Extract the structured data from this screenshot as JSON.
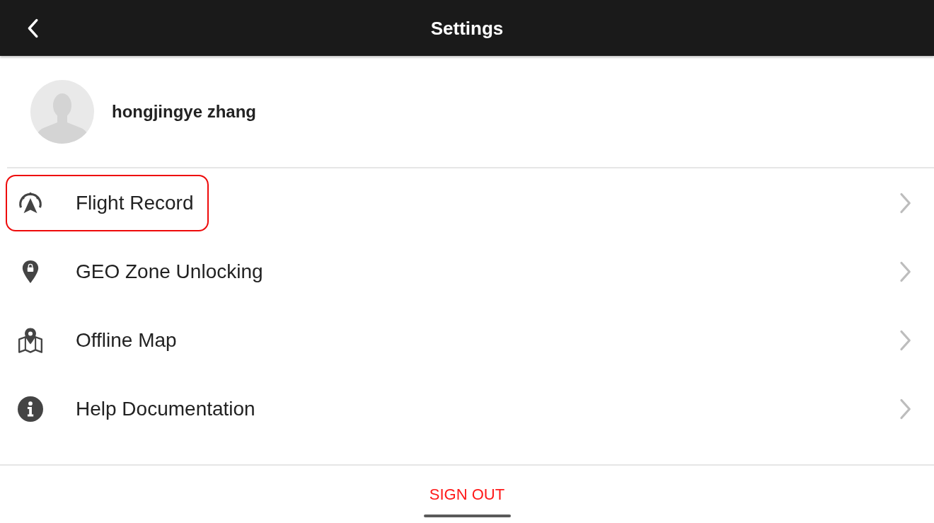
{
  "header": {
    "title": "Settings"
  },
  "profile": {
    "name": "hongjingye zhang"
  },
  "menu": [
    {
      "kind": "flight-record",
      "label": "Flight Record",
      "highlighted": true
    },
    {
      "kind": "geo-zone",
      "label": "GEO Zone Unlocking",
      "highlighted": false
    },
    {
      "kind": "offline-map",
      "label": "Offline Map",
      "highlighted": false
    },
    {
      "kind": "help",
      "label": "Help Documentation",
      "highlighted": false
    }
  ],
  "sign_out": {
    "label": "SIGN OUT"
  }
}
